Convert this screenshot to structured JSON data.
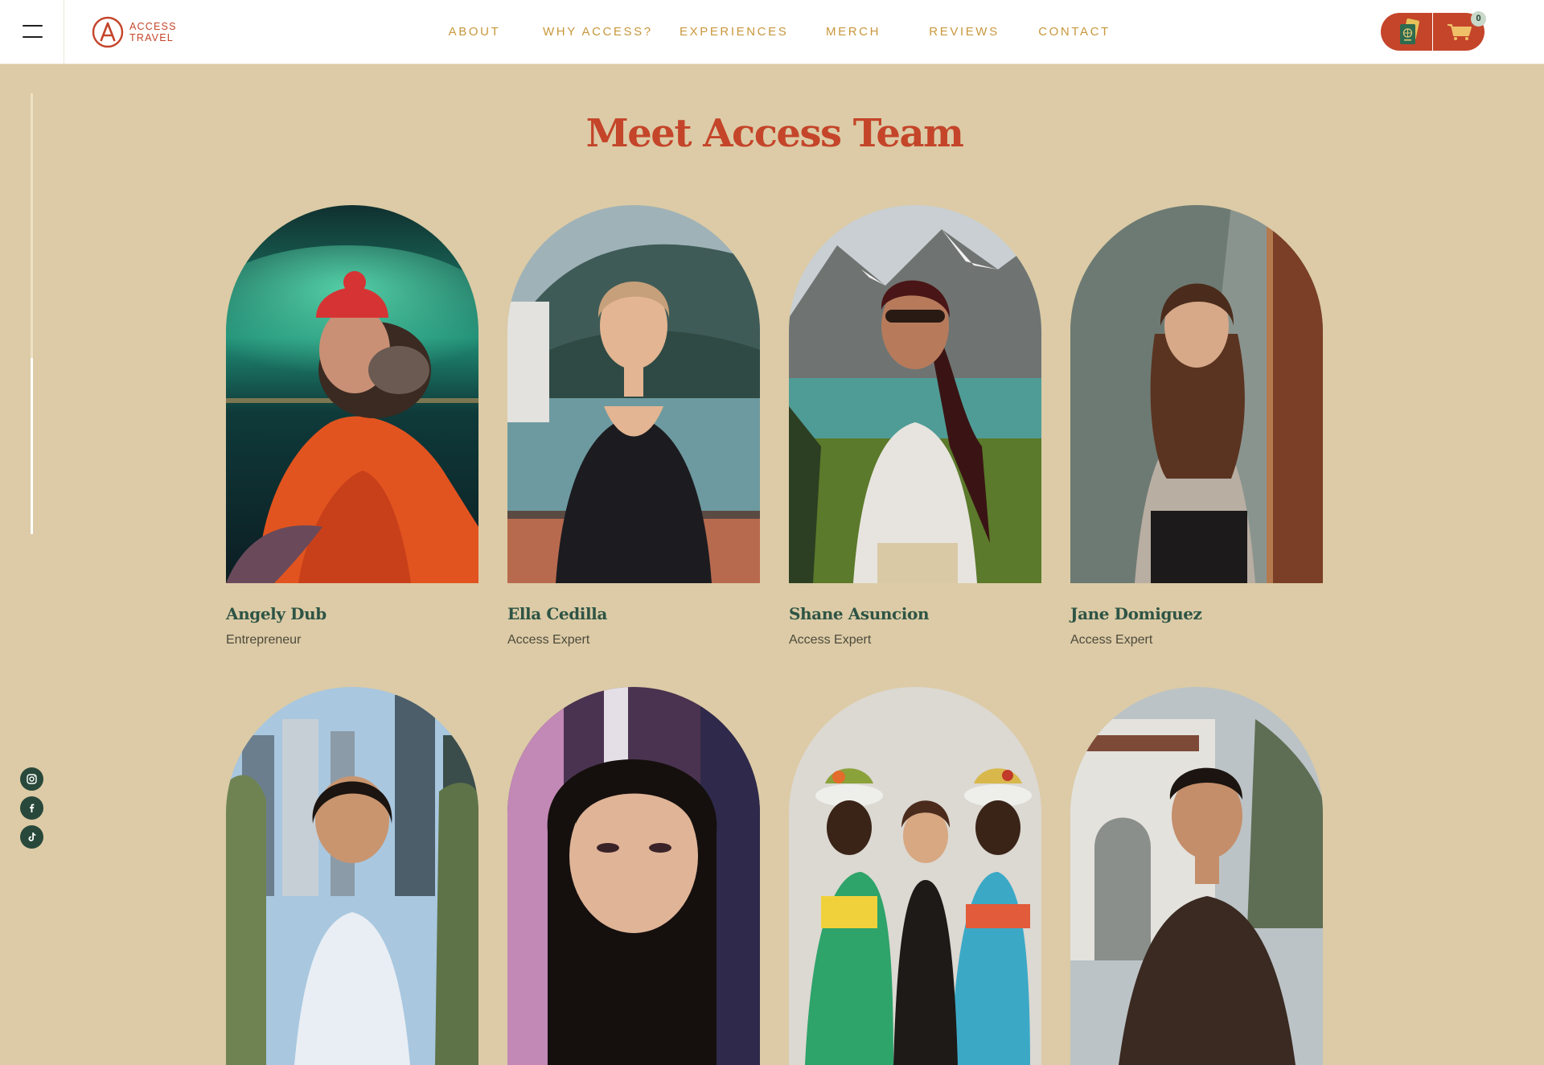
{
  "brand": {
    "line1": "ACCESS",
    "line2": "TRAVEL",
    "logo_icon": "access-a-logo-icon"
  },
  "nav": [
    "ABOUT",
    "WHY ACCESS?",
    "EXPERIENCES",
    "MERCH",
    "REVIEWS",
    "CONTACT"
  ],
  "header": {
    "menu_icon": "hamburger-menu-icon",
    "passport_icon": "passport-icon",
    "cart_icon": "cart-icon",
    "cart_count": "0"
  },
  "social": [
    "instagram-icon",
    "facebook-icon",
    "tiktok-icon"
  ],
  "section": {
    "title": "Meet Access Team"
  },
  "team": [
    {
      "name": "Angely Dub",
      "role": "Entrepreneur"
    },
    {
      "name": "Ella Cedilla",
      "role": "Access Expert"
    },
    {
      "name": "Shane Asuncion",
      "role": "Access Expert"
    },
    {
      "name": "Jane Domiguez",
      "role": "Access Expert"
    },
    {
      "name": "",
      "role": ""
    },
    {
      "name": "",
      "role": ""
    },
    {
      "name": "",
      "role": ""
    },
    {
      "name": "",
      "role": ""
    }
  ],
  "colors": {
    "background": "#dccba6",
    "accent": "#c4452a",
    "nav": "#c8973c",
    "name": "#2e5445",
    "social": "#28483b"
  }
}
